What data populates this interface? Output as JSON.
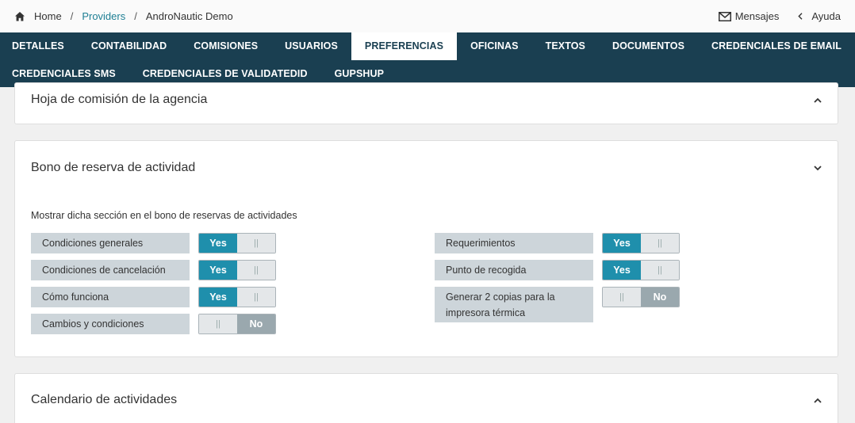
{
  "breadcrumb": {
    "home": "Home",
    "sep1": "/",
    "providers": "Providers",
    "sep2": "/",
    "current": "AndroNautic Demo"
  },
  "top_actions": {
    "messages": "Mensajes",
    "help": "Ayuda"
  },
  "tabs": {
    "row1": [
      "DETALLES",
      "CONTABILIDAD",
      "COMISIONES",
      "USUARIOS",
      "PREFERENCIAS",
      "OFICINAS",
      "TEXTOS",
      "DOCUMENTOS",
      "CREDENCIALES DE EMAIL"
    ],
    "row2": [
      "CREDENCIALES SMS",
      "CREDENCIALES DE VALIDATEDID",
      "GUPSHUP"
    ],
    "active": "PREFERENCIAS"
  },
  "sections": {
    "agency_commission": {
      "title": "Hoja de comisión de la agencia"
    },
    "activity_voucher": {
      "title": "Bono de reserva de actividad",
      "subtitle": "Mostrar dicha sección en el bono de reservas de actividades",
      "left": [
        {
          "label": "Condiciones generales",
          "value": "Yes"
        },
        {
          "label": "Condiciones de cancelación",
          "value": "Yes"
        },
        {
          "label": "Cómo funciona",
          "value": "Yes"
        },
        {
          "label": "Cambios y condiciones",
          "value": "No"
        }
      ],
      "right": [
        {
          "label": "Requerimientos",
          "value": "Yes"
        },
        {
          "label": "Punto de recogida",
          "value": "Yes"
        },
        {
          "label": "Generar 2 copias para la impresora térmica",
          "value": "No"
        }
      ]
    },
    "activity_calendar": {
      "title": "Calendario de actividades"
    }
  },
  "toggle_text": {
    "yes": "Yes",
    "no": "No",
    "handle": "||"
  },
  "colors": {
    "nav_bg": "#1a3f51",
    "toggle_on": "#1f8fac",
    "toggle_no": "#9aa8ae",
    "label_bg": "#cdd5da"
  }
}
